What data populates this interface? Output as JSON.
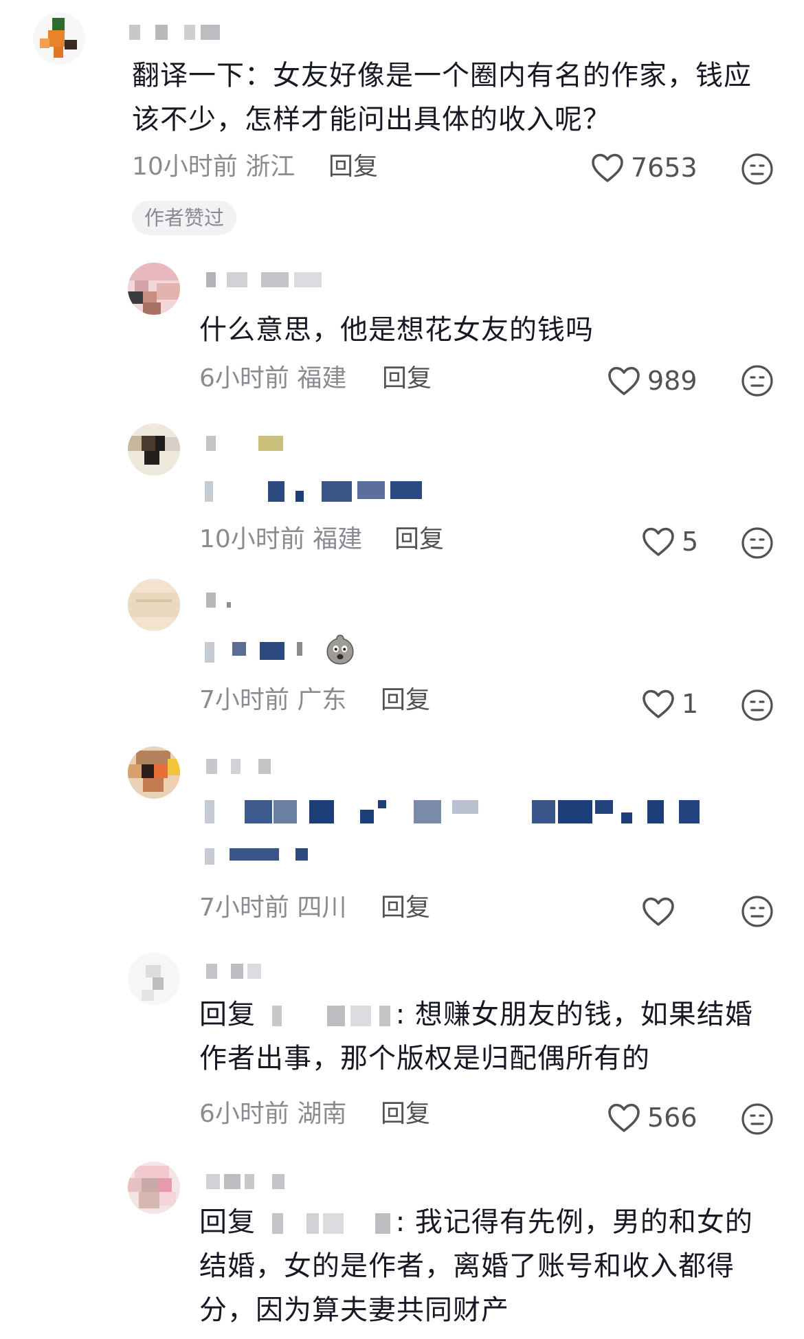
{
  "comments": [
    {
      "text": "翻译一下：女友好像是一个圈内有名的作家，钱应该不少，怎样才能问出具体的收入呢？",
      "line1": "翻译一下：女友好像是一个圈内有名的作家，钱应",
      "line2": "该不少，怎样才能问出具体的收入呢？",
      "meta": "10小时前 浙江",
      "reply": "回复",
      "likes": "7653",
      "badge": "作者赞过"
    },
    {
      "text": "什么意思，他是想花女友的钱吗",
      "meta": "6小时前 福建",
      "reply": "回复",
      "likes": "989"
    },
    {
      "meta": "10小时前 福建",
      "reply": "回复",
      "likes": "5"
    },
    {
      "meta": "7小时前 广东",
      "reply": "回复",
      "likes": "1"
    },
    {
      "meta": "7小时前 四川",
      "reply": "回复",
      "likes": ""
    },
    {
      "reply_prefix": "回复",
      "line1_tail": ": 想赚女朋友的钱，如果结婚",
      "line2": "作者出事，那个版权是归配偶所有的",
      "meta": "6小时前 湖南",
      "reply": "回复",
      "likes": "566"
    },
    {
      "reply_prefix": "回复",
      "line1_tail": ": 我记得有先例，男的和女的",
      "line2": "结婚，女的是作者，离婚了账号和收入都得",
      "line3": "分，因为算夫妻共同财产"
    }
  ],
  "icons": {
    "like": "heart-outline-icon",
    "dislike": "meh-face-icon",
    "emoji": "shocked-face-emoji"
  },
  "colors": {
    "text": "#161823",
    "meta": "#8a8b91",
    "action": "#515256",
    "blur_blue": "#1c3f7a"
  }
}
